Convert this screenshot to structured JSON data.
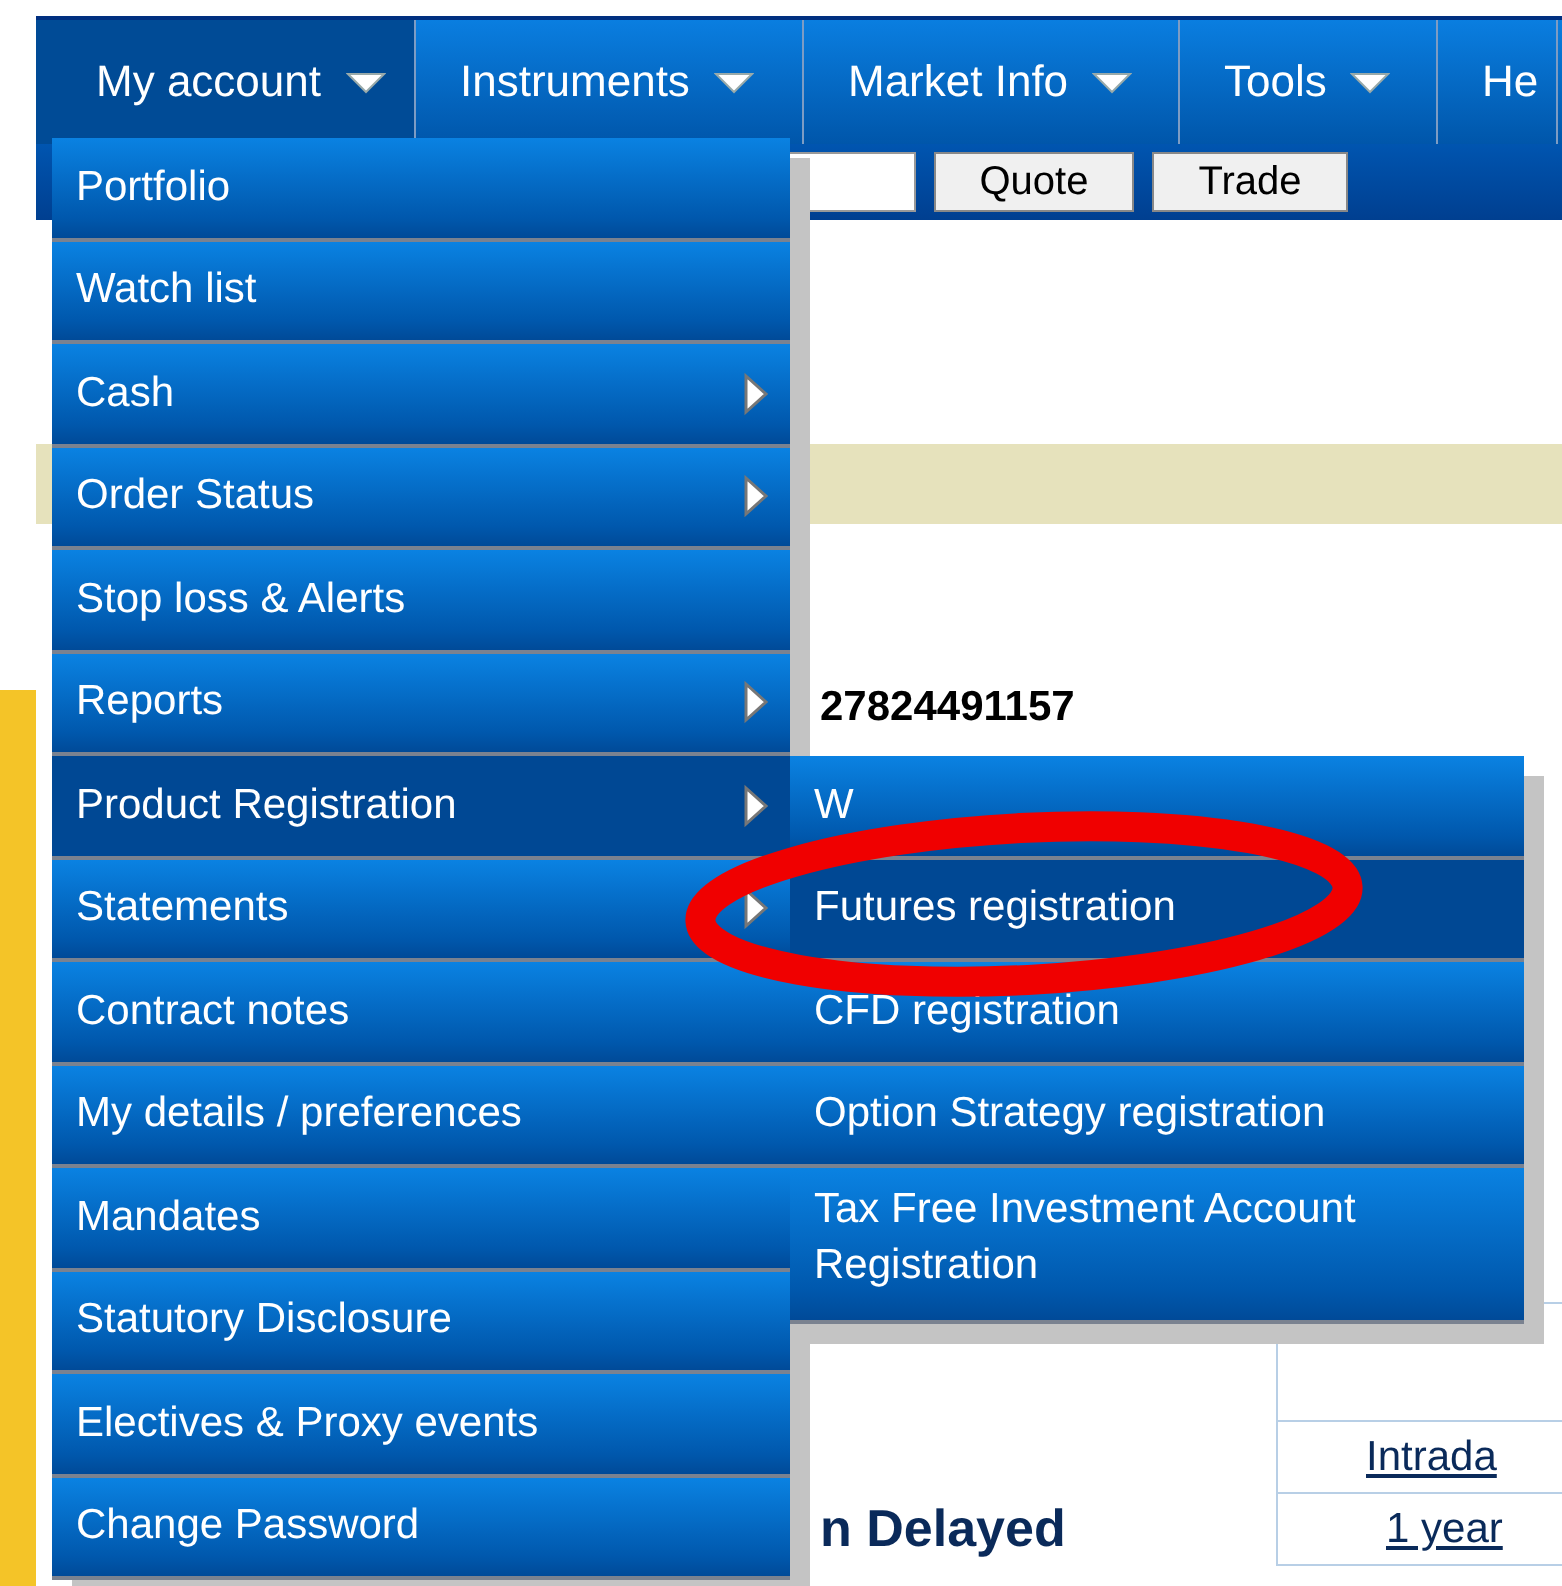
{
  "nav": {
    "items": [
      {
        "label": "My account",
        "selected": true,
        "caret": true
      },
      {
        "label": "Instruments",
        "selected": false,
        "caret": true
      },
      {
        "label": "Market Info",
        "selected": false,
        "caret": true
      },
      {
        "label": "Tools",
        "selected": false,
        "caret": true
      },
      {
        "label": "He",
        "selected": false,
        "caret": false
      }
    ]
  },
  "quote_bar": {
    "buttons": [
      "Quote",
      "Trade"
    ]
  },
  "account_number": "27824491157",
  "links": [
    "Intrada",
    "1 year"
  ],
  "heading_fragment": "n Delayed",
  "menu": {
    "items": [
      {
        "label": "Portfolio",
        "submenu": false,
        "selected": false
      },
      {
        "label": "Watch list",
        "submenu": false,
        "selected": false
      },
      {
        "label": "Cash",
        "submenu": true,
        "selected": false
      },
      {
        "label": "Order Status",
        "submenu": true,
        "selected": false
      },
      {
        "label": "Stop loss & Alerts",
        "submenu": false,
        "selected": false
      },
      {
        "label": "Reports",
        "submenu": true,
        "selected": false
      },
      {
        "label": "Product Registration",
        "submenu": true,
        "selected": true
      },
      {
        "label": "Statements",
        "submenu": true,
        "selected": false
      },
      {
        "label": "Contract notes",
        "submenu": false,
        "selected": false
      },
      {
        "label": "My details / preferences",
        "submenu": false,
        "selected": false
      },
      {
        "label": "Mandates",
        "submenu": false,
        "selected": false
      },
      {
        "label": "Statutory Disclosure",
        "submenu": false,
        "selected": false
      },
      {
        "label": "Electives & Proxy events",
        "submenu": false,
        "selected": false
      },
      {
        "label": "Change Password",
        "submenu": false,
        "selected": false
      }
    ]
  },
  "submenu": {
    "items": [
      {
        "label": "W",
        "selected": false
      },
      {
        "label": "Futures registration",
        "selected": true
      },
      {
        "label": "CFD registration",
        "selected": false
      },
      {
        "label": "Option Strategy registration",
        "selected": false
      },
      {
        "label": "Tax Free Investment Account Registration",
        "selected": false
      }
    ]
  },
  "annotation": {
    "shown": true
  }
}
